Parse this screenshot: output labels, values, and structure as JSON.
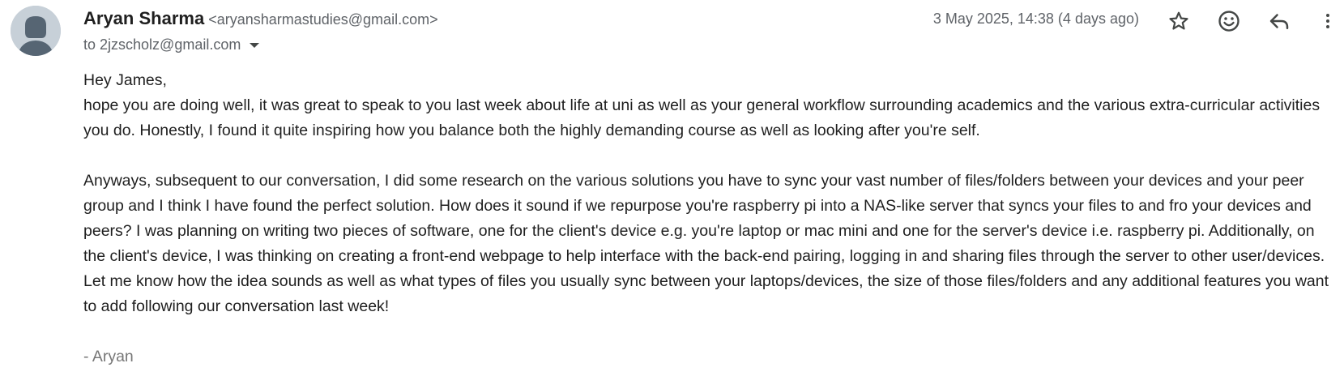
{
  "sender": {
    "name": "Aryan Sharma",
    "email": "<aryansharmastudies@gmail.com>"
  },
  "recipient": {
    "text": "to 2jzscholz@gmail.com"
  },
  "timestamp": "3 May 2025, 14:38 (4 days ago)",
  "actions": {
    "star": "star-icon",
    "emoji": "emoji-icon",
    "reply": "reply-icon",
    "more": "more-vert-icon"
  },
  "body": {
    "greeting": "Hey James,",
    "paragraph1": "hope you are doing well, it was great to speak to you last week about life at uni as well as your general workflow surrounding academics and the various extra-curricular activities you do. Honestly, I found it quite inspiring how you balance both the highly demanding course as well as looking after you're self.",
    "paragraph2": "Anyways, subsequent to our conversation, I did some research on the various solutions you have to sync your vast number of files/folders between your devices and your  peer group and I think I have found the perfect solution. How does it sound if we repurpose you're raspberry pi into a NAS-like server that syncs your files to and fro your devices and peers? I was planning on writing two pieces of software, one for the client's device e.g. you're laptop or mac mini and one for the server's device i.e. raspberry pi. Additionally, on the client's device, I was thinking on creating a front-end webpage to help interface with the back-end pairing, logging in and sharing files through the server to other user/devices. Let me know how the idea sounds as well as what types of files you usually sync between your laptops/devices, the size of those files/folders and any additional features you want to add following our conversation last week!",
    "signature": "- Aryan"
  }
}
